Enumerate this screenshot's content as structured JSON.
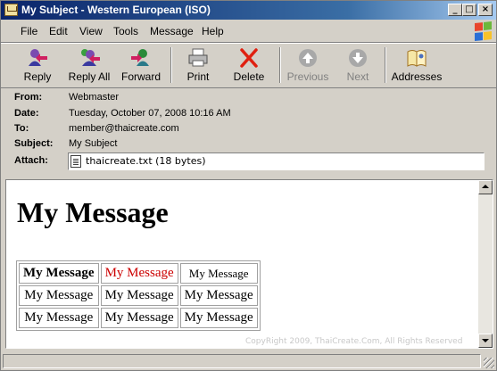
{
  "window": {
    "title": "My Subject - Western European (ISO)",
    "controls": [
      "_",
      "□",
      "×"
    ]
  },
  "menu": [
    "File",
    "Edit",
    "View",
    "Tools",
    "Message",
    "Help"
  ],
  "toolbar": {
    "reply": "Reply",
    "reply_all": "Reply All",
    "forward": "Forward",
    "print": "Print",
    "delete": "Delete",
    "previous": "Previous",
    "next": "Next",
    "addresses": "Addresses"
  },
  "header": {
    "from_label": "From:",
    "from": "Webmaster",
    "date_label": "Date:",
    "date": "Tuesday, October 07, 2008 10:16 AM",
    "to_label": "To:",
    "to": "member@thaicreate.com",
    "subject_label": "Subject:",
    "subject": "My Subject",
    "attach_label": "Attach:",
    "attachment": "thaicreate.txt (18 bytes)"
  },
  "message": {
    "heading": "My Message",
    "table": [
      [
        "My Message",
        "My Message",
        "My Message"
      ],
      [
        "My Message",
        "My Message",
        "My Message"
      ],
      [
        "My Message",
        "My Message",
        "My Message"
      ]
    ],
    "copyright": "CopyRight 2009, ThaiCreate.Com, All Rights Reserved"
  },
  "colors": {
    "titlebar": "#0a246a",
    "red_text": "#cc0000"
  }
}
